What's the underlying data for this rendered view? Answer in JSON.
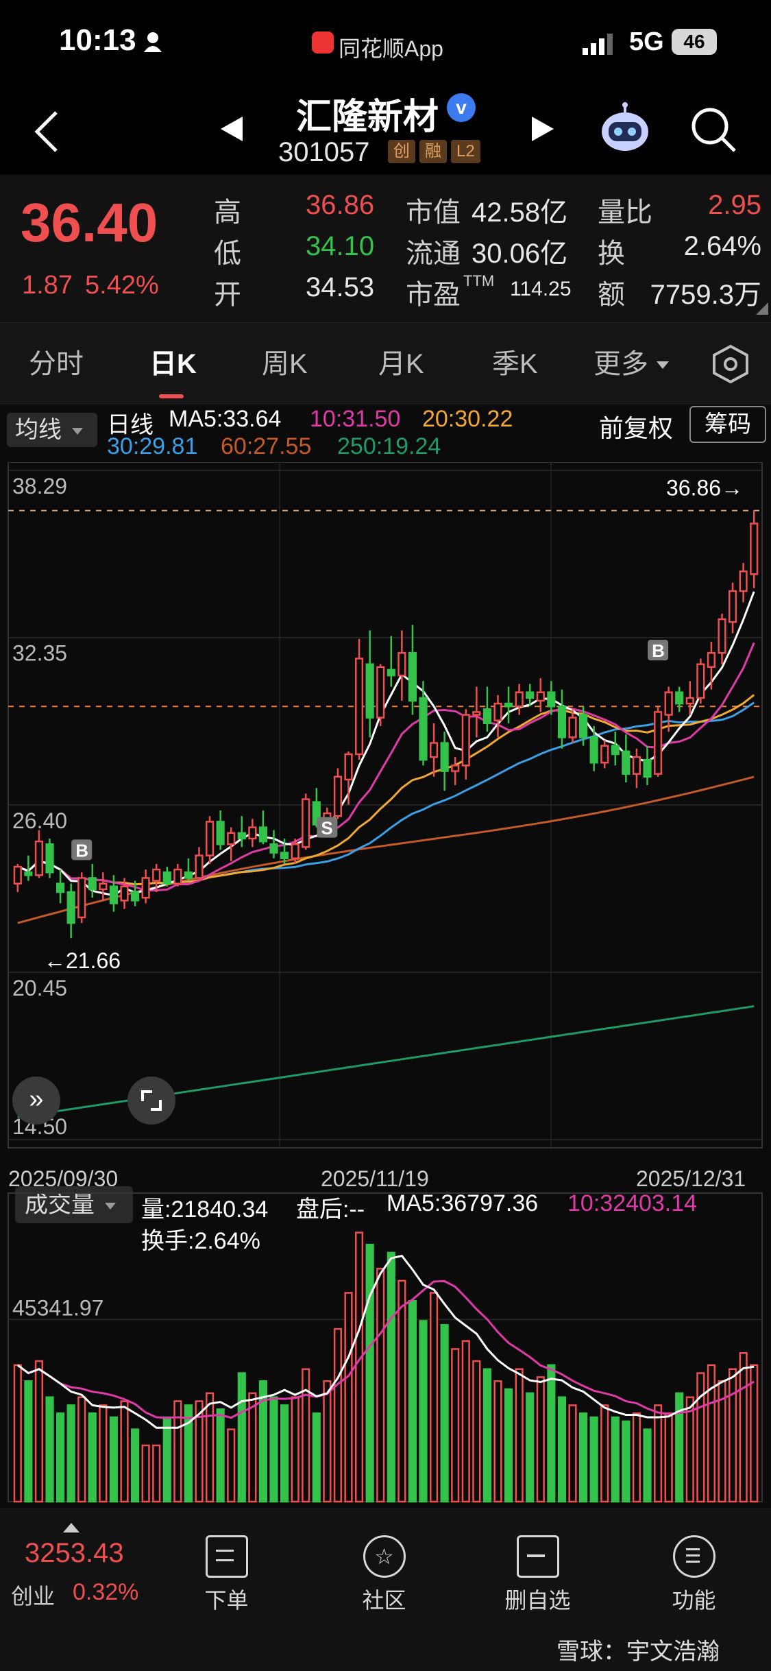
{
  "status_bar": {
    "time": "10:13",
    "app_name": "同花顺App",
    "network": "5G",
    "battery": "46"
  },
  "header": {
    "stock_name": "汇隆新材",
    "stock_code": "301057",
    "badges": [
      "创",
      "融",
      "L2"
    ]
  },
  "quote": {
    "price": "36.40",
    "change": "1.87",
    "change_pct": "5.42%",
    "high_label": "高",
    "high": "36.86",
    "low_label": "低",
    "low": "34.10",
    "open_label": "开",
    "open": "34.53",
    "mktcap_label": "市值",
    "mktcap": "42.58亿",
    "float_label": "流通",
    "float": "30.06亿",
    "pe_label": "市盈",
    "pe_sup": "TTM",
    "pe": "114.25",
    "vol_ratio_label": "量比",
    "vol_ratio": "2.95",
    "turnover_label": "换",
    "turnover": "2.64%",
    "amount_label": "额",
    "amount": "7759.3万"
  },
  "tabs": {
    "items": [
      "分时",
      "日K",
      "周K",
      "月K",
      "季K",
      "更多"
    ],
    "active": 1
  },
  "ma_bar": {
    "selector": "均线",
    "period": "日线",
    "ma5": "MA5:33.64",
    "ma10": "10:31.50",
    "ma20": "20:30.22",
    "ma30": "30:29.81",
    "ma60": "60:27.55",
    "ma250": "250:19.24",
    "adjust": "前复权",
    "chips": "筹码"
  },
  "colors": {
    "up": "#ef4f4f",
    "down": "#33c24a",
    "ma5": "#ffffff",
    "ma10": "#e03aa8",
    "ma20": "#f0a830",
    "ma30": "#3aa0e8",
    "ma60": "#c45a28",
    "ma250": "#1f9a6a"
  },
  "chart_data": {
    "type": "candlestick",
    "y_axis_labels": [
      "38.29",
      "32.35",
      "26.40",
      "20.45",
      "14.50"
    ],
    "ylim": [
      14.5,
      38.29
    ],
    "x_axis_labels": [
      "2025/09/30",
      "2025/11/19",
      "2025/12/31"
    ],
    "high_marker": "36.86",
    "low_marker": "21.66",
    "signals": [
      "B",
      "S",
      "B"
    ],
    "candles": [
      [
        23.6,
        24.3,
        23.3,
        24.2
      ],
      [
        24.0,
        24.6,
        23.7,
        23.9
      ],
      [
        23.9,
        25.5,
        23.8,
        25.1
      ],
      [
        25.0,
        25.2,
        23.8,
        24.0
      ],
      [
        23.6,
        24.1,
        22.9,
        23.3
      ],
      [
        23.3,
        23.6,
        21.66,
        22.2
      ],
      [
        22.4,
        24.0,
        22.2,
        23.8
      ],
      [
        23.8,
        24.3,
        23.1,
        23.4
      ],
      [
        23.4,
        24.0,
        23.0,
        23.6
      ],
      [
        23.5,
        23.9,
        22.6,
        22.9
      ],
      [
        23.0,
        23.8,
        22.7,
        23.5
      ],
      [
        23.3,
        23.7,
        22.8,
        23.0
      ],
      [
        23.1,
        24.1,
        22.9,
        23.8
      ],
      [
        23.7,
        24.3,
        23.3,
        24.1
      ],
      [
        24.0,
        24.2,
        23.5,
        23.6
      ],
      [
        23.6,
        24.3,
        23.5,
        24.1
      ],
      [
        24.0,
        24.5,
        23.7,
        23.8
      ],
      [
        23.8,
        24.9,
        23.7,
        24.6
      ],
      [
        24.6,
        26.0,
        24.3,
        25.8
      ],
      [
        25.8,
        26.2,
        24.8,
        25.0
      ],
      [
        25.0,
        25.6,
        24.4,
        25.4
      ],
      [
        25.4,
        26.0,
        24.9,
        25.2
      ],
      [
        25.2,
        25.9,
        24.9,
        25.6
      ],
      [
        25.6,
        26.2,
        25.0,
        25.1
      ],
      [
        25.0,
        25.5,
        24.5,
        24.7
      ],
      [
        24.7,
        25.2,
        24.3,
        24.5
      ],
      [
        24.5,
        25.2,
        24.3,
        25.0
      ],
      [
        24.9,
        26.8,
        24.8,
        26.6
      ],
      [
        26.5,
        27.0,
        25.6,
        25.7
      ],
      [
        25.7,
        26.3,
        25.4,
        26.1
      ],
      [
        26.0,
        27.7,
        25.9,
        27.4
      ],
      [
        27.3,
        28.3,
        26.4,
        28.2
      ],
      [
        28.2,
        32.3,
        28.0,
        31.6
      ],
      [
        31.4,
        32.6,
        28.8,
        29.5
      ],
      [
        29.5,
        31.4,
        29.2,
        31.3
      ],
      [
        31.2,
        32.4,
        30.6,
        31.0
      ],
      [
        31.0,
        32.6,
        30.1,
        31.8
      ],
      [
        31.8,
        32.8,
        29.6,
        30.1
      ],
      [
        30.2,
        30.8,
        27.8,
        28.0
      ],
      [
        28.1,
        29.3,
        27.4,
        28.6
      ],
      [
        28.6,
        29.0,
        26.9,
        27.6
      ],
      [
        27.6,
        28.1,
        27.1,
        27.8
      ],
      [
        27.8,
        29.8,
        27.3,
        29.6
      ],
      [
        29.6,
        30.6,
        28.8,
        29.7
      ],
      [
        29.8,
        30.6,
        29.0,
        29.3
      ],
      [
        29.4,
        30.3,
        28.8,
        30.0
      ],
      [
        30.0,
        30.6,
        29.3,
        29.9
      ],
      [
        29.9,
        30.7,
        29.6,
        30.4
      ],
      [
        30.4,
        30.7,
        29.9,
        30.2
      ],
      [
        30.1,
        30.9,
        29.7,
        30.4
      ],
      [
        30.4,
        30.8,
        29.6,
        29.9
      ],
      [
        29.9,
        30.5,
        28.4,
        28.8
      ],
      [
        28.8,
        29.8,
        28.6,
        29.5
      ],
      [
        29.6,
        29.9,
        28.5,
        28.8
      ],
      [
        28.8,
        29.2,
        27.6,
        27.9
      ],
      [
        27.9,
        28.7,
        27.7,
        28.5
      ],
      [
        28.5,
        29.0,
        27.8,
        28.2
      ],
      [
        28.3,
        28.9,
        27.2,
        27.5
      ],
      [
        27.5,
        28.4,
        27.0,
        28.1
      ],
      [
        28.0,
        28.5,
        27.1,
        27.4
      ],
      [
        27.5,
        29.9,
        27.4,
        29.7
      ],
      [
        29.6,
        30.6,
        29.0,
        30.4
      ],
      [
        30.4,
        30.6,
        29.7,
        30.0
      ],
      [
        30.0,
        30.8,
        29.6,
        30.2
      ],
      [
        30.2,
        31.6,
        30.0,
        31.4
      ],
      [
        31.3,
        32.2,
        30.5,
        31.8
      ],
      [
        31.8,
        33.2,
        31.4,
        33.0
      ],
      [
        32.9,
        34.3,
        32.5,
        34.0
      ],
      [
        34.0,
        35.0,
        33.6,
        34.7
      ],
      [
        34.6,
        36.86,
        34.1,
        36.4
      ]
    ],
    "volume": {
      "title": "成交量",
      "vol": "量:21840.34",
      "after_hours": "盘后:--",
      "ma5": "MA5:36797.36",
      "ma10": "10:32403.14",
      "turnover": "换手:2.64%",
      "axis_label": "45341.97",
      "values": [
        34000,
        30000,
        35000,
        26000,
        22000,
        24000,
        26000,
        22000,
        24000,
        21000,
        25000,
        18000,
        14000,
        14000,
        21000,
        25000,
        24000,
        25000,
        27000,
        23000,
        18000,
        32000,
        27000,
        30000,
        26000,
        24000,
        26000,
        33000,
        22000,
        30000,
        43000,
        52000,
        67000,
        64000,
        58000,
        62000,
        55000,
        50000,
        45000,
        52000,
        44000,
        38000,
        40000,
        35000,
        33000,
        30000,
        28000,
        33000,
        27000,
        31000,
        34000,
        26000,
        24000,
        22000,
        21000,
        24000,
        21000,
        20000,
        22000,
        18000,
        24000,
        22000,
        27000,
        26000,
        32000,
        34000,
        30000,
        33000,
        37000,
        34000
      ]
    }
  },
  "bottom_nav": {
    "index_value": "3253.43",
    "index_name": "创业",
    "index_change": "0.32%",
    "items": [
      "下单",
      "社区",
      "删自选",
      "功能"
    ],
    "watermark": "雪球：宇文浩瀚"
  }
}
